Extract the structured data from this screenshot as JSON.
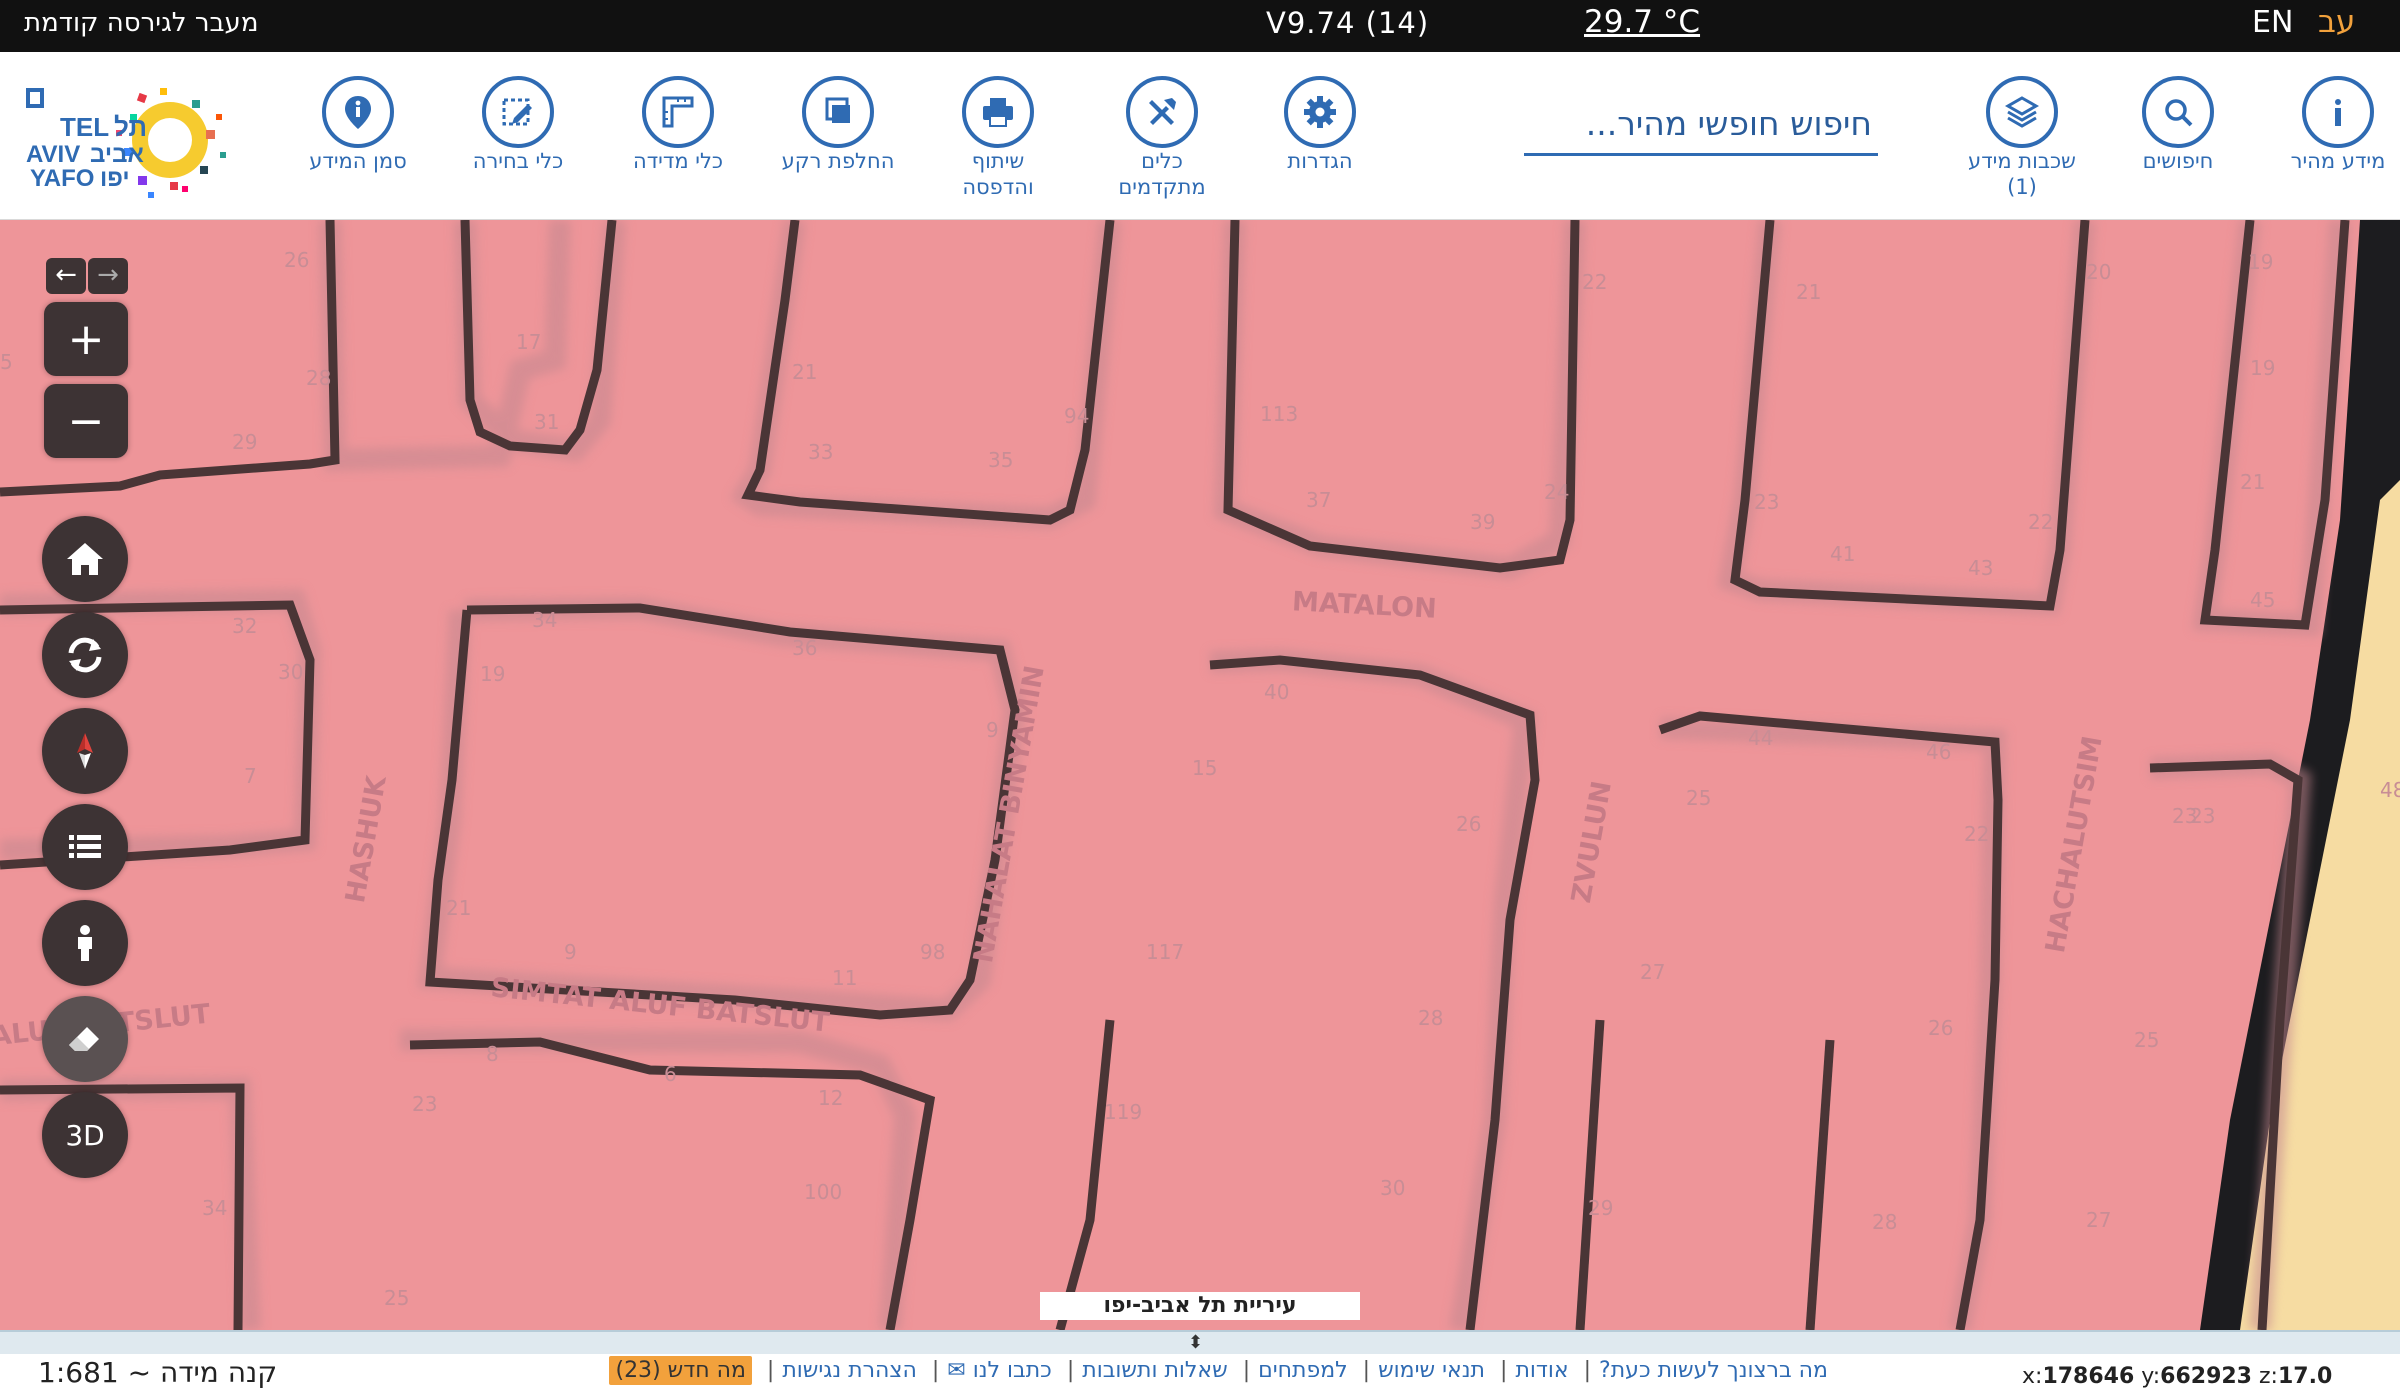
{
  "topbar": {
    "prev_version": "מעבר לגירסה קודמת",
    "version": "V9.74 (14)",
    "temperature": "29.7 °C",
    "lang_en": "EN",
    "lang_he": "עב"
  },
  "toolbar": {
    "search_placeholder": "חיפוש חופשי מהיר...",
    "tools": {
      "quick_info": "מידע מהיר",
      "searches": "חיפושים",
      "info_layers": "שכבות מידע\n(1)",
      "settings": "הגדרות",
      "advanced_tools": "כלים\nמתקדמים",
      "share_print": "שיתוף\nוהדפסה",
      "basemap": "החלפת רקע",
      "measure": "כלי מדידה",
      "select": "כלי בחירה",
      "info_marker": "סמן המידע"
    },
    "logo_text": [
      "תל",
      "TEL",
      "אביב",
      "AVIV",
      "יפו",
      "YAFO"
    ]
  },
  "map": {
    "streets": [
      "MATALON",
      "NAHALAT BINYAMIN",
      "ZVULUN",
      "HACHALUTSIM",
      "HASHUK",
      "SIMTAT ALUF BATSLUT",
      "ALUF BATSLUT"
    ],
    "house_numbers": [
      "26",
      "28",
      "29",
      "17",
      "31",
      "21",
      "33",
      "35",
      "94",
      "113",
      "37",
      "39",
      "24",
      "22",
      "21",
      "23",
      "41",
      "43",
      "20",
      "22",
      "19",
      "19",
      "21",
      "45",
      "32",
      "34",
      "36",
      "30",
      "19",
      "9",
      "7",
      "40",
      "15",
      "44",
      "46",
      "25",
      "21",
      "9",
      "11",
      "98",
      "117",
      "26",
      "27",
      "23",
      "48",
      "23",
      "22",
      "8",
      "6",
      "12",
      "100",
      "23",
      "34",
      "119",
      "28",
      "26",
      "25",
      "30",
      "29",
      "28",
      "27",
      "25",
      "5"
    ],
    "city_label": "עיריית תל אביב-יפו",
    "controls": {
      "arrow_back": "←",
      "arrow_fwd": "→",
      "zoom_in": "+",
      "zoom_out": "−",
      "three_d": "3D"
    },
    "colors": {
      "zone_fill": "#ee9599",
      "block_outline": "#4a3536",
      "sea": "#f6dca2",
      "coast": "#1c1c1f"
    }
  },
  "bottom": {
    "scale": "קנה מידה ~ 1:681",
    "links": [
      "מה ברצונך לעשות כעת?",
      "אודות",
      "תנאי שימוש",
      "למפתחים",
      "שאלות ותשובות",
      "כתבו לנו ✉",
      "הצהרת נגישות"
    ],
    "whats_new": "מה חדש (23)",
    "coords": {
      "x_label": "x:",
      "x": "178646",
      "y_label": "y:",
      "y": "662923",
      "z_label": "z:",
      "z": "17.0"
    }
  }
}
